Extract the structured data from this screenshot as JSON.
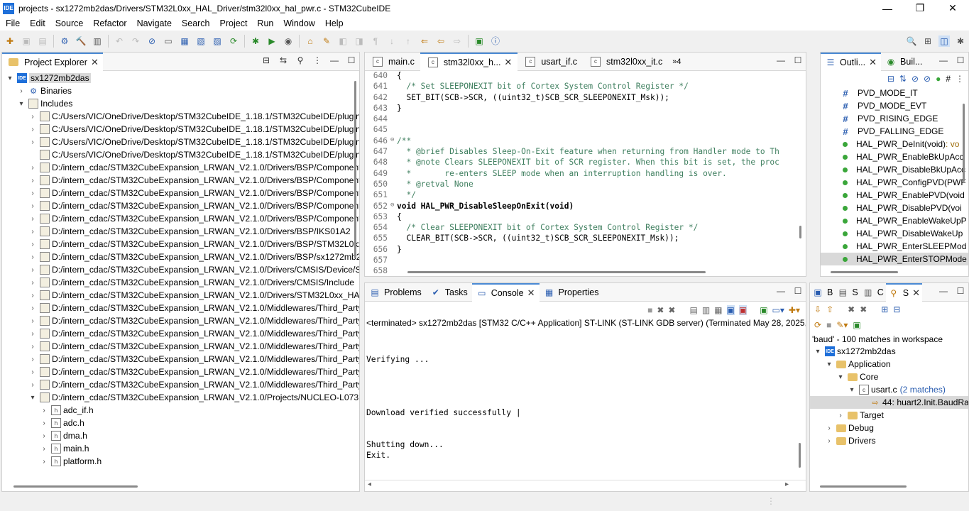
{
  "window": {
    "app_icon": "IDE",
    "title": "projects - sx1272mb2das/Drivers/STM32L0xx_HAL_Driver/stm32l0xx_hal_pwr.c - STM32CubeIDE",
    "min": "—",
    "max": "❐",
    "close": "✕"
  },
  "menu": [
    "File",
    "Edit",
    "Source",
    "Refactor",
    "Navigate",
    "Search",
    "Project",
    "Run",
    "Window",
    "Help"
  ],
  "project_explorer": {
    "tab": "Project Explorer",
    "items": [
      {
        "indent": 0,
        "tw": "▾",
        "icon": "proj",
        "label": "sx1272mb2das",
        "selected": true
      },
      {
        "indent": 1,
        "tw": "›",
        "icon": "bin",
        "label": "Binaries"
      },
      {
        "indent": 1,
        "tw": "▾",
        "icon": "inc",
        "label": "Includes"
      },
      {
        "indent": 2,
        "tw": "›",
        "icon": "inc",
        "label": "C:/Users/VIC/OneDrive/Desktop/STM32CubeIDE_1.18.1/STM32CubeIDE/plugins"
      },
      {
        "indent": 2,
        "tw": "›",
        "icon": "inc",
        "label": "C:/Users/VIC/OneDrive/Desktop/STM32CubeIDE_1.18.1/STM32CubeIDE/plugins"
      },
      {
        "indent": 2,
        "tw": "›",
        "icon": "inc",
        "label": "C:/Users/VIC/OneDrive/Desktop/STM32CubeIDE_1.18.1/STM32CubeIDE/plugins"
      },
      {
        "indent": 2,
        "tw": "",
        "icon": "inc",
        "label": "C:/Users/VIC/OneDrive/Desktop/STM32CubeIDE_1.18.1/STM32CubeIDE/plugins"
      },
      {
        "indent": 2,
        "tw": "›",
        "icon": "inc",
        "label": "D:/intern_cdac/STM32CubeExpansion_LRWAN_V2.1.0/Drivers/BSP/Components"
      },
      {
        "indent": 2,
        "tw": "›",
        "icon": "inc",
        "label": "D:/intern_cdac/STM32CubeExpansion_LRWAN_V2.1.0/Drivers/BSP/Components"
      },
      {
        "indent": 2,
        "tw": "›",
        "icon": "inc",
        "label": "D:/intern_cdac/STM32CubeExpansion_LRWAN_V2.1.0/Drivers/BSP/Components"
      },
      {
        "indent": 2,
        "tw": "›",
        "icon": "inc",
        "label": "D:/intern_cdac/STM32CubeExpansion_LRWAN_V2.1.0/Drivers/BSP/Components"
      },
      {
        "indent": 2,
        "tw": "›",
        "icon": "inc",
        "label": "D:/intern_cdac/STM32CubeExpansion_LRWAN_V2.1.0/Drivers/BSP/Components"
      },
      {
        "indent": 2,
        "tw": "›",
        "icon": "inc",
        "label": "D:/intern_cdac/STM32CubeExpansion_LRWAN_V2.1.0/Drivers/BSP/IKS01A2"
      },
      {
        "indent": 2,
        "tw": "›",
        "icon": "inc",
        "label": "D:/intern_cdac/STM32CubeExpansion_LRWAN_V2.1.0/Drivers/BSP/STM32L0xx_N"
      },
      {
        "indent": 2,
        "tw": "›",
        "icon": "inc",
        "label": "D:/intern_cdac/STM32CubeExpansion_LRWAN_V2.1.0/Drivers/BSP/sx1272mb2d"
      },
      {
        "indent": 2,
        "tw": "›",
        "icon": "inc",
        "label": "D:/intern_cdac/STM32CubeExpansion_LRWAN_V2.1.0/Drivers/CMSIS/Device/ST"
      },
      {
        "indent": 2,
        "tw": "›",
        "icon": "inc",
        "label": "D:/intern_cdac/STM32CubeExpansion_LRWAN_V2.1.0/Drivers/CMSIS/Include"
      },
      {
        "indent": 2,
        "tw": "›",
        "icon": "inc",
        "label": "D:/intern_cdac/STM32CubeExpansion_LRWAN_V2.1.0/Drivers/STM32L0xx_HAL_"
      },
      {
        "indent": 2,
        "tw": "›",
        "icon": "inc",
        "label": "D:/intern_cdac/STM32CubeExpansion_LRWAN_V2.1.0/Middlewares/Third_Party"
      },
      {
        "indent": 2,
        "tw": "›",
        "icon": "inc",
        "label": "D:/intern_cdac/STM32CubeExpansion_LRWAN_V2.1.0/Middlewares/Third_Party"
      },
      {
        "indent": 2,
        "tw": "›",
        "icon": "inc",
        "label": "D:/intern_cdac/STM32CubeExpansion_LRWAN_V2.1.0/Middlewares/Third_Party"
      },
      {
        "indent": 2,
        "tw": "›",
        "icon": "inc",
        "label": "D:/intern_cdac/STM32CubeExpansion_LRWAN_V2.1.0/Middlewares/Third_Party"
      },
      {
        "indent": 2,
        "tw": "›",
        "icon": "inc",
        "label": "D:/intern_cdac/STM32CubeExpansion_LRWAN_V2.1.0/Middlewares/Third_Party"
      },
      {
        "indent": 2,
        "tw": "›",
        "icon": "inc",
        "label": "D:/intern_cdac/STM32CubeExpansion_LRWAN_V2.1.0/Middlewares/Third_Party"
      },
      {
        "indent": 2,
        "tw": "›",
        "icon": "inc",
        "label": "D:/intern_cdac/STM32CubeExpansion_LRWAN_V2.1.0/Middlewares/Third_Party"
      },
      {
        "indent": 2,
        "tw": "▾",
        "icon": "inc",
        "label": "D:/intern_cdac/STM32CubeExpansion_LRWAN_V2.1.0/Projects/NUCLEO-L073RZ"
      },
      {
        "indent": 3,
        "tw": "›",
        "icon": "hdr",
        "label": "adc_if.h"
      },
      {
        "indent": 3,
        "tw": "›",
        "icon": "hdr",
        "label": "adc.h"
      },
      {
        "indent": 3,
        "tw": "›",
        "icon": "hdr",
        "label": "dma.h"
      },
      {
        "indent": 3,
        "tw": "›",
        "icon": "hdr",
        "label": "main.h"
      },
      {
        "indent": 3,
        "tw": "›",
        "icon": "hdr",
        "label": "platform.h"
      }
    ]
  },
  "editor": {
    "tabs": [
      {
        "label": "main.c",
        "active": false
      },
      {
        "label": "stm32l0xx_h...",
        "active": true
      },
      {
        "label": "usart_if.c",
        "active": false
      },
      {
        "label": "stm32l0xx_it.c",
        "active": false
      }
    ],
    "overflow": "»4",
    "lines": [
      {
        "n": "640",
        "f": "",
        "t": "{"
      },
      {
        "n": "641",
        "f": "",
        "t": "  /* Set SLEEPONEXIT bit of Cortex System Control Register */",
        "c": "cm"
      },
      {
        "n": "642",
        "f": "",
        "t": "  SET_BIT(SCB->SCR, ((uint32_t)SCB_SCR_SLEEPONEXIT_Msk));"
      },
      {
        "n": "643",
        "f": "",
        "t": "}"
      },
      {
        "n": "644",
        "f": "",
        "t": ""
      },
      {
        "n": "645",
        "f": "",
        "t": ""
      },
      {
        "n": "646",
        "f": "⊖",
        "t": "/**",
        "c": "cm"
      },
      {
        "n": "647",
        "f": "",
        "t": "  * @brief Disables Sleep-On-Exit feature when returning from Handler mode to Th",
        "c": "cm"
      },
      {
        "n": "648",
        "f": "",
        "t": "  * @note Clears SLEEPONEXIT bit of SCR register. When this bit is set, the proc",
        "c": "cm"
      },
      {
        "n": "649",
        "f": "",
        "t": "  *       re-enters SLEEP mode when an interruption handling is over.",
        "c": "cm"
      },
      {
        "n": "650",
        "f": "",
        "t": "  * @retval None",
        "c": "cm"
      },
      {
        "n": "651",
        "f": "",
        "t": "  */",
        "c": "cm"
      },
      {
        "n": "652",
        "f": "⊖",
        "t": "void HAL_PWR_DisableSleepOnExit(void)",
        "c": "fn"
      },
      {
        "n": "653",
        "f": "",
        "t": "{"
      },
      {
        "n": "654",
        "f": "",
        "t": "  /* Clear SLEEPONEXIT bit of Cortex System Control Register */",
        "c": "cm"
      },
      {
        "n": "655",
        "f": "",
        "t": "  CLEAR_BIT(SCB->SCR, ((uint32_t)SCB_SCR_SLEEPONEXIT_Msk));"
      },
      {
        "n": "656",
        "f": "",
        "t": "}"
      },
      {
        "n": "657",
        "f": "",
        "t": ""
      },
      {
        "n": "658",
        "f": "",
        "t": ""
      }
    ]
  },
  "outline": {
    "tab1": "Outli...",
    "tab2": "Buil...",
    "items": [
      {
        "kind": "macro",
        "label": "PVD_MODE_IT"
      },
      {
        "kind": "macro",
        "label": "PVD_MODE_EVT"
      },
      {
        "kind": "macro",
        "label": "PVD_RISING_EDGE"
      },
      {
        "kind": "macro",
        "label": "PVD_FALLING_EDGE"
      },
      {
        "kind": "func",
        "label": "HAL_PWR_DeInit(void)",
        "suffix": " : vo"
      },
      {
        "kind": "func",
        "label": "HAL_PWR_EnableBkUpAcc"
      },
      {
        "kind": "func",
        "label": "HAL_PWR_DisableBkUpAcc"
      },
      {
        "kind": "func",
        "label": "HAL_PWR_ConfigPVD(PWF"
      },
      {
        "kind": "func",
        "label": "HAL_PWR_EnablePVD(void"
      },
      {
        "kind": "func",
        "label": "HAL_PWR_DisablePVD(voi"
      },
      {
        "kind": "func",
        "label": "HAL_PWR_EnableWakeUpP"
      },
      {
        "kind": "func",
        "label": "HAL_PWR_DisableWakeUp"
      },
      {
        "kind": "func",
        "label": "HAL_PWR_EnterSLEEPMod"
      },
      {
        "kind": "func",
        "label": "HAL_PWR_EnterSTOPMode",
        "selected": true
      }
    ]
  },
  "console": {
    "tabs": [
      "Problems",
      "Tasks",
      "Console",
      "Properties"
    ],
    "active": "Console",
    "header": "<terminated> sx1272mb2das [STM32 C/C++ Application] ST-LINK (ST-LINK GDB server) (Terminated May 28, 2025, 3:4",
    "lines": [
      "",
      "",
      "Verifying ...",
      "",
      "",
      "",
      "",
      "Download verified successfully |",
      "",
      "",
      "Shutting down...",
      "Exit."
    ]
  },
  "search": {
    "tabs": [
      "B",
      "S",
      "C",
      "S"
    ],
    "summary": "'baud' - 100 matches in workspace",
    "tree": [
      {
        "indent": 0,
        "tw": "▾",
        "icon": "proj",
        "label": "sx1272mb2das"
      },
      {
        "indent": 1,
        "tw": "▾",
        "icon": "fold",
        "label": "Application"
      },
      {
        "indent": 2,
        "tw": "▾",
        "icon": "fold",
        "label": "Core"
      },
      {
        "indent": 3,
        "tw": "▾",
        "icon": "file",
        "label": "usart.c",
        "extra": "(2 matches)"
      },
      {
        "indent": 4,
        "tw": "",
        "icon": "match",
        "label": "44: huart2.Init.BaudRate",
        "selected": true
      },
      {
        "indent": 2,
        "tw": "›",
        "icon": "fold",
        "label": "Target"
      },
      {
        "indent": 1,
        "tw": "›",
        "icon": "fold",
        "label": "Debug"
      },
      {
        "indent": 1,
        "tw": "›",
        "icon": "fold",
        "label": "Drivers"
      }
    ]
  },
  "icons": {
    "close": "✕",
    "minimize": "—",
    "maximize": "☐",
    "search": "🔍"
  },
  "colors": {
    "accent": "#4a8ad4",
    "comment": "#3f7f5f",
    "keyword": "#7f0055",
    "match_count": "#2a5db0"
  }
}
